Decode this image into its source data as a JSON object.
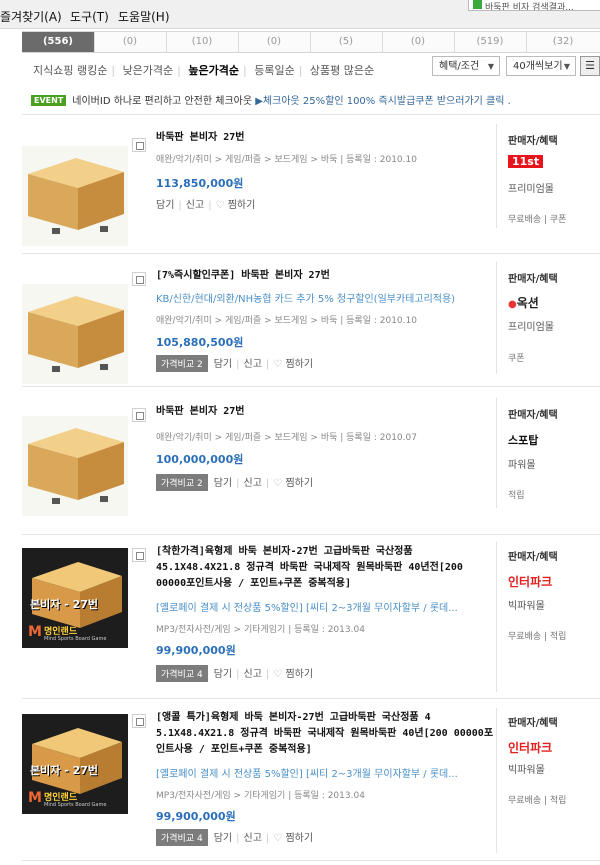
{
  "menu": {
    "favorites": "즐겨찾기(A)",
    "tools": "도구(T)",
    "help": "도움말(H)",
    "tab_snippet": "바둑판 비자 검색결과..."
  },
  "counts": [
    "(556)",
    "(0)",
    "(10)",
    "(0)",
    "(5)",
    "(0)",
    "(519)",
    "(32)"
  ],
  "sort_tabs": [
    "지식쇼핑 랭킹순",
    "낮은가격순",
    "높은가격순",
    "등록일순",
    "상품평 많은순"
  ],
  "sort_active_index": 2,
  "filter_select": "혜택/조건",
  "page_size_select": "40개씩보기",
  "event_banner": {
    "badge": "EVENT",
    "text": "네이버ID 하나로 편리하고 안전한 체크아웃",
    "link": "▶체크아웃 25%할인 100% 즉시발급쿠폰 받으러가기 클릭 ."
  },
  "seller_heading": "판매자/혜택",
  "compare_label": "가격비교",
  "cart_label": "담기",
  "report_label": "신고",
  "wish_label": "찜하기",
  "items": [
    {
      "title": "바둑판 본비자 27번",
      "promo": "",
      "category": [
        "애완/악기/취미",
        "게임/퍼즐",
        "보드게임",
        "바둑"
      ],
      "reg_date": "등록일 : 2010.10",
      "price": "113,850,000원",
      "compare_count": "",
      "seller_logo": "11st",
      "seller_grade": "프리미엄몰",
      "shipping": [
        "무료배송",
        "쿠폰"
      ]
    },
    {
      "title": "[7%즉시할인쿠폰] 바둑판 본비자 27번",
      "promo": "KB/신한/현대/외환/NH농협 카드 추가 5% 청구할인(일부카테고리적용)",
      "category": [
        "애완/악기/취미",
        "게임/퍼즐",
        "보드게임",
        "바둑"
      ],
      "reg_date": "등록일 : 2010.10",
      "price": "105,880,500원",
      "compare_count": "2",
      "seller_logo": "옥션",
      "seller_grade": "프리미엄몰",
      "shipping": [
        "쿠폰"
      ]
    },
    {
      "title": "바둑판 본비자 27번",
      "promo": "",
      "category": [
        "애완/악기/취미",
        "게임/퍼즐",
        "보드게임",
        "바둑"
      ],
      "reg_date": "등록일 : 2010.07",
      "price": "100,000,000원",
      "compare_count": "2",
      "seller_logo": "스포탑",
      "seller_grade": "파워몰",
      "shipping": [
        "적립"
      ]
    },
    {
      "title": "[착한가격]육형제 바둑 본비자-27번 고급바둑판 국산정품 45.1X48.4X21.8 정규격 바둑판 국내제작 원목바둑판 40년전[200 00000포인트사용 / 포인트+쿠폰 중복적용]",
      "promo": "[옐로페이 결제 시 전상품 5%할인] [씨티 2~3개월 무이자할부 / 롯데...",
      "category": [
        "MP3/전자사전/게임",
        "기타게임기"
      ],
      "reg_date": "등록일 : 2013.04",
      "price": "99,900,000원",
      "compare_count": "4",
      "seller_logo": "인터파크",
      "seller_grade": "빅파워몰",
      "shipping": [
        "무료배송",
        "적립"
      ],
      "thumb_text": "본비자 - 27번",
      "thumb_brand": "명인랜드",
      "thumb_sub": "Mind Sports Board Game"
    },
    {
      "title": "[앵콜 특가]육형제 바둑 본비자-27번 고급바둑판 국산정품 4 5.1X48.4X21.8 정규격 바둑판 국내제작 원목바둑판 40년[200 00000포인트사용 / 포인트+쿠폰 중복적용]",
      "promo": "[옐로페이 결제 시 전상품 5%할인] [씨티 2~3개월 무이자할부 / 롯데...",
      "category": [
        "MP3/전자사전/게임",
        "기타게임기"
      ],
      "reg_date": "등록일 : 2013.04",
      "price": "99,900,000원",
      "compare_count": "4",
      "seller_logo": "인터파크",
      "seller_grade": "빅파워몰",
      "shipping": [
        "무료배송",
        "적립"
      ],
      "thumb_text": "본비자 - 27번",
      "thumb_brand": "명인랜드",
      "thumb_sub": "Mind Sports Board Game"
    }
  ],
  "colors": {
    "price": "#2a6fb8",
    "promo": "#4a8fc7",
    "event_badge": "#4aa020",
    "active_count": "#6b6b6b"
  }
}
